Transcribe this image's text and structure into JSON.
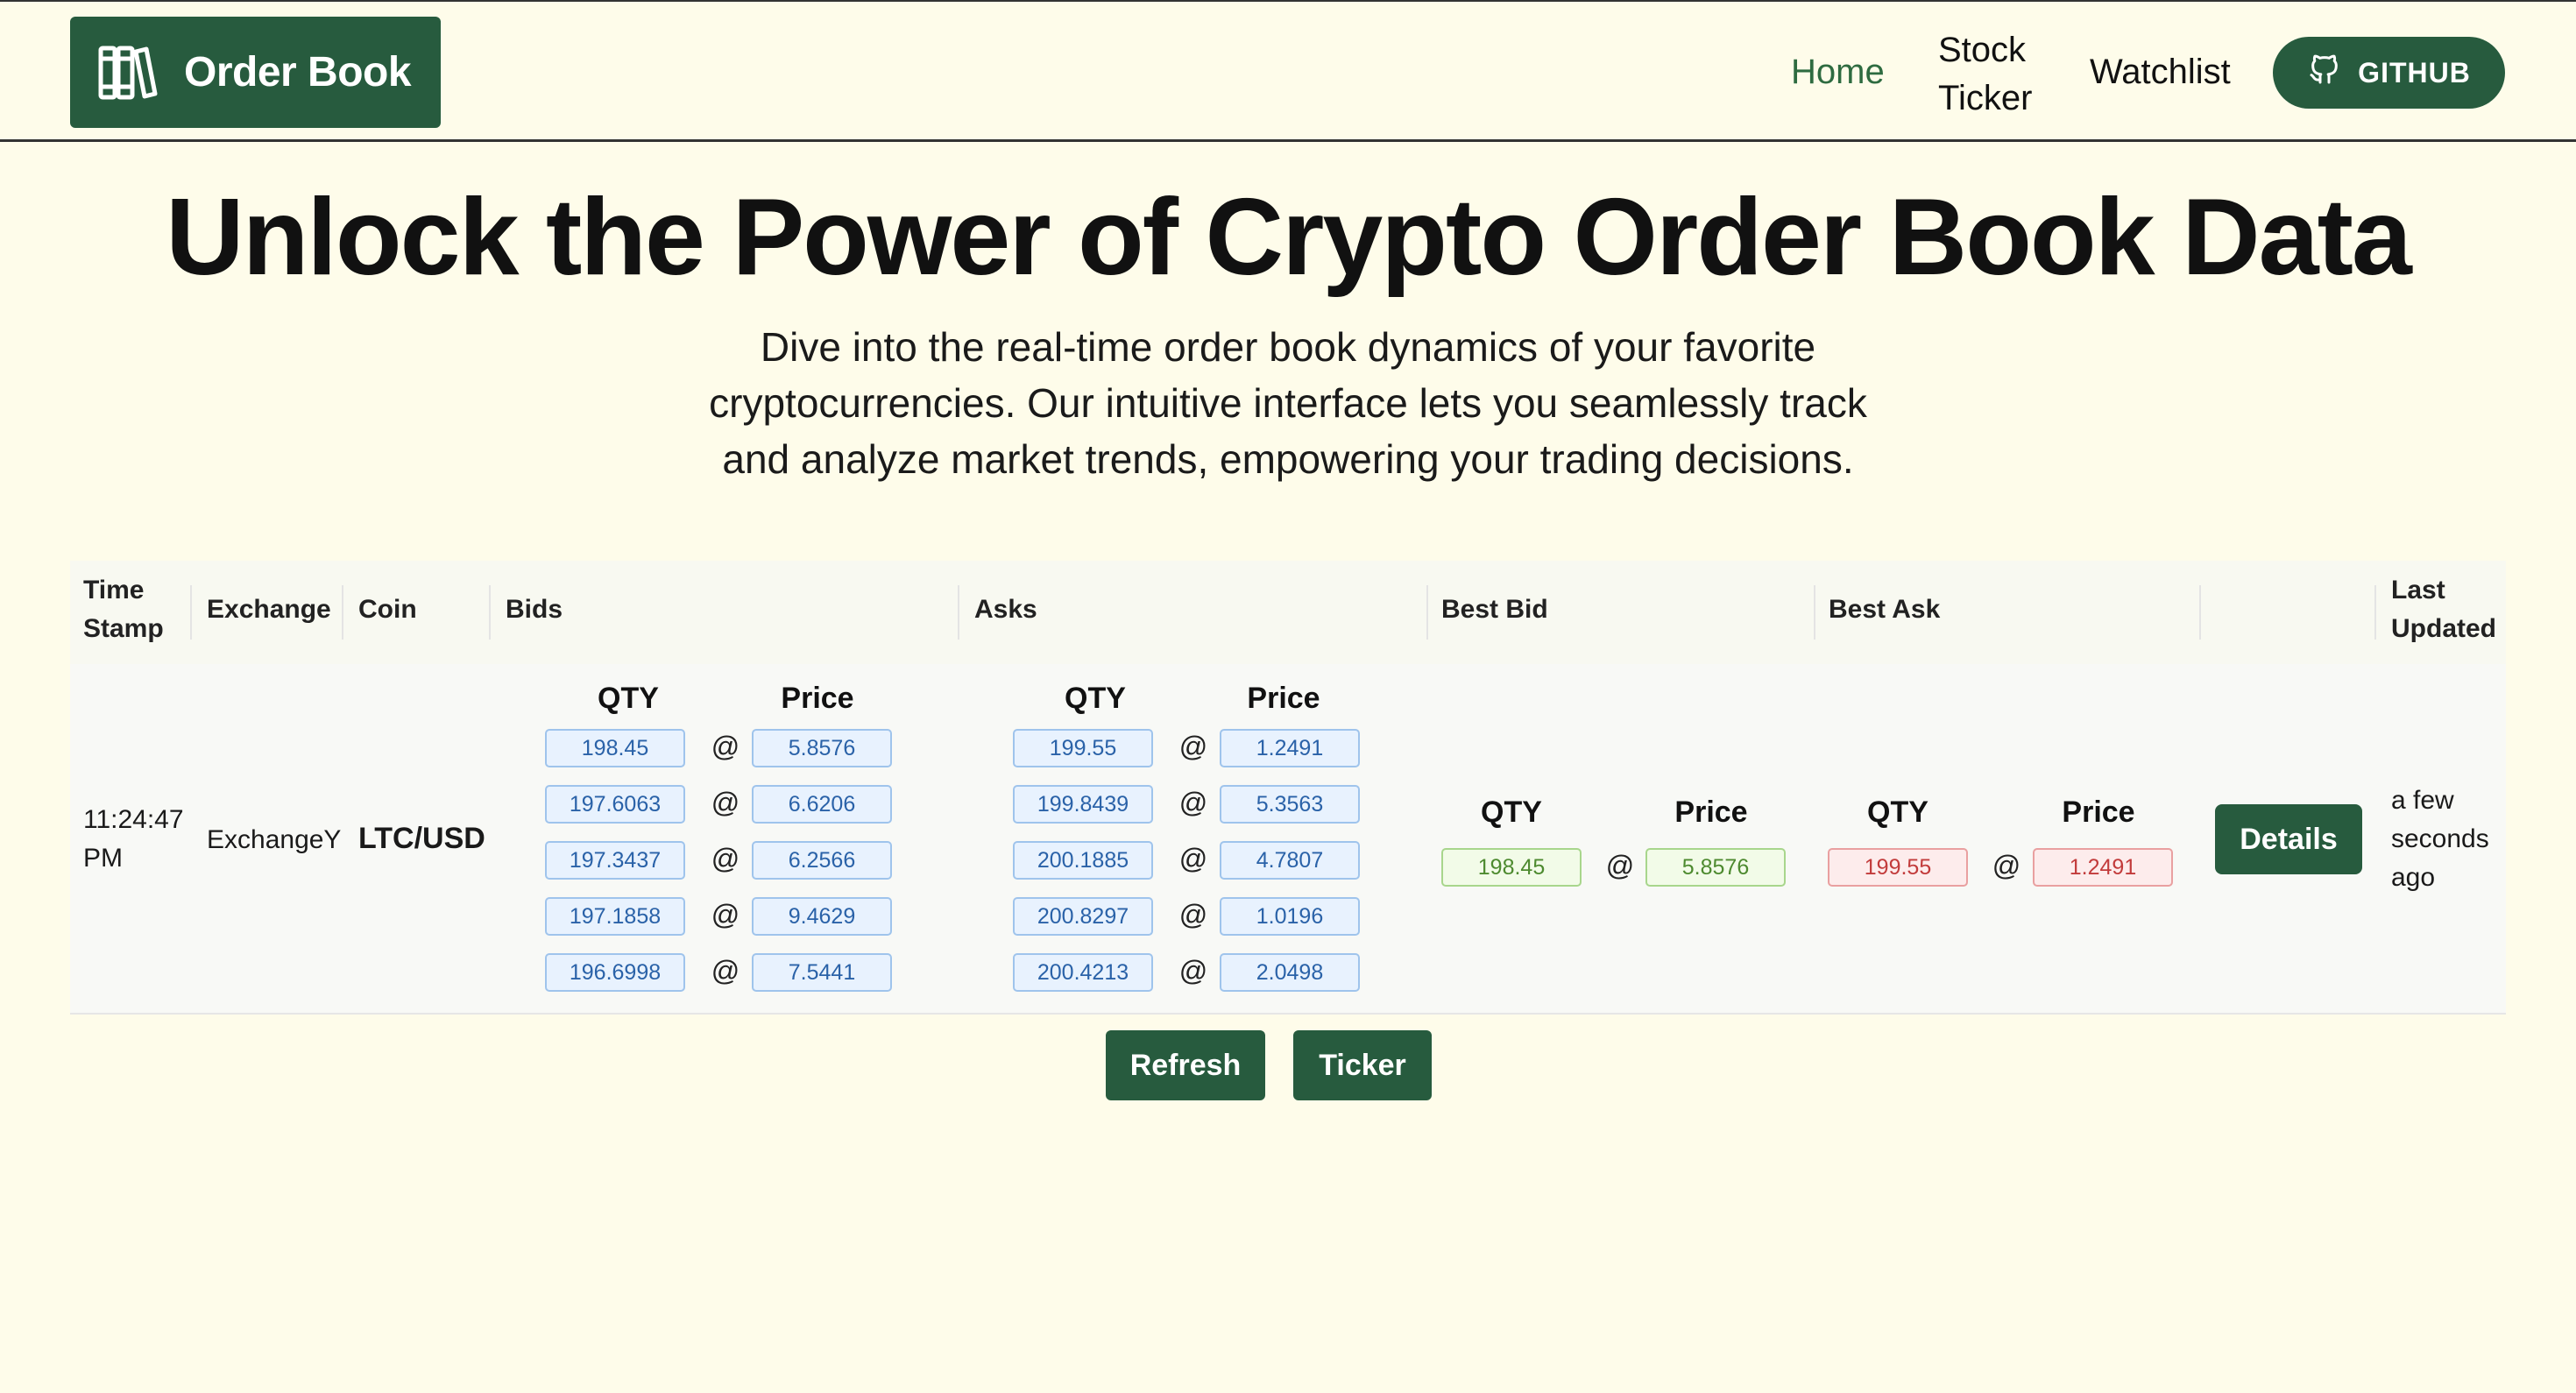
{
  "header": {
    "brand": "Order Book",
    "brand_icon": "books-icon",
    "nav": {
      "home": "Home",
      "stock_ticker": "Stock Ticker",
      "watchlist": "Watchlist",
      "github": "GITHUB"
    }
  },
  "hero": {
    "title": "Unlock the Power of Crypto Order Book Data",
    "lead": "Dive into the real-time order book dynamics of your favorite cryptocurrencies. Our intuitive interface lets you seamlessly track and analyze market trends, empowering your trading decisions."
  },
  "table": {
    "headers": {
      "time_stamp": "Time Stamp",
      "exchange": "Exchange",
      "coin": "Coin",
      "bids": "Bids",
      "asks": "Asks",
      "best_bid": "Best Bid",
      "best_ask": "Best Ask",
      "last_updated": "Last Updated"
    },
    "sub_headers": {
      "qty": "QTY",
      "price": "Price",
      "at": "@"
    },
    "row": {
      "time": "11:24:47 PM",
      "exchange": "ExchangeY",
      "coin": "LTC/USD",
      "bids": [
        {
          "qty": "198.45",
          "price": "5.8576"
        },
        {
          "qty": "197.6063",
          "price": "6.6206"
        },
        {
          "qty": "197.3437",
          "price": "6.2566"
        },
        {
          "qty": "197.1858",
          "price": "9.4629"
        },
        {
          "qty": "196.6998",
          "price": "7.5441"
        }
      ],
      "asks": [
        {
          "qty": "199.55",
          "price": "1.2491"
        },
        {
          "qty": "199.8439",
          "price": "5.3563"
        },
        {
          "qty": "200.1885",
          "price": "4.7807"
        },
        {
          "qty": "200.8297",
          "price": "1.0196"
        },
        {
          "qty": "200.4213",
          "price": "2.0498"
        }
      ],
      "best_bid": {
        "qty": "198.45",
        "price": "5.8576"
      },
      "best_ask": {
        "qty": "199.55",
        "price": "1.2491"
      },
      "details": "Details",
      "last_updated": "a few seconds ago"
    }
  },
  "actions": {
    "refresh": "Refresh",
    "ticker": "Ticker"
  },
  "colors": {
    "brand": "#275b3e",
    "background": "#fefcea",
    "bid_pill": "#e8f2fe",
    "best_bid": "#4d8a2f",
    "best_ask": "#c23b3b"
  }
}
